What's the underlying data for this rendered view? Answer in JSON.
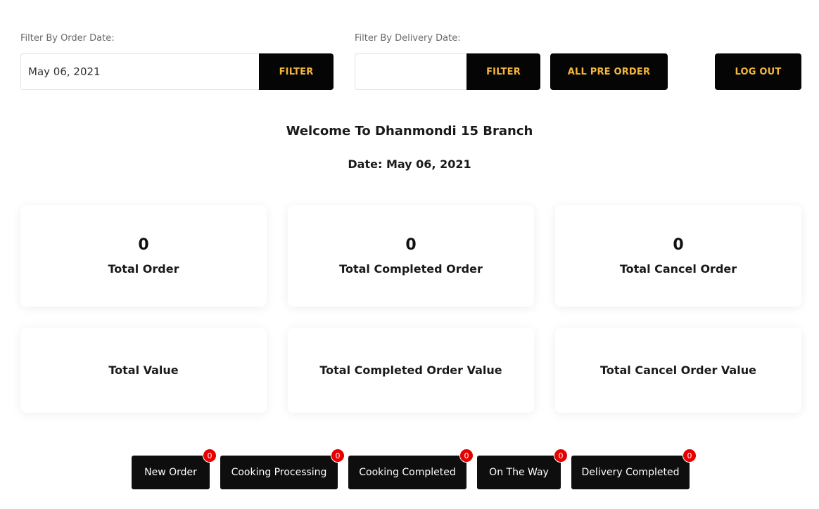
{
  "filters": {
    "order_date_label": "Filter By Order Date:",
    "order_date_value": "May 06, 2021",
    "delivery_date_label": "Filter By Delivery Date:",
    "delivery_date_value": "",
    "filter_button": "FILTER",
    "all_pre_order_button": "ALL PRE ORDER",
    "logout_button": "LOG OUT"
  },
  "header": {
    "welcome": "Welcome To Dhanmondi 15 Branch",
    "date_line": "Date: May 06, 2021"
  },
  "stats": {
    "total_order": {
      "value": "0",
      "label": "Total Order"
    },
    "total_completed_order": {
      "value": "0",
      "label": "Total Completed Order"
    },
    "total_cancel_order": {
      "value": "0",
      "label": "Total Cancel Order"
    },
    "total_value": {
      "label": "Total Value"
    },
    "total_completed_order_value": {
      "label": "Total Completed Order Value"
    },
    "total_cancel_order_value": {
      "label": "Total Cancel Order Value"
    }
  },
  "status_buttons": [
    {
      "label": "New Order",
      "count": "0"
    },
    {
      "label": "Cooking Processing",
      "count": "0"
    },
    {
      "label": "Cooking Completed",
      "count": "0"
    },
    {
      "label": "On The Way",
      "count": "0"
    },
    {
      "label": "Delivery Completed",
      "count": "0"
    }
  ],
  "colors": {
    "button_bg": "#050505",
    "button_text": "#f4b63d",
    "badge": "#e60000"
  }
}
